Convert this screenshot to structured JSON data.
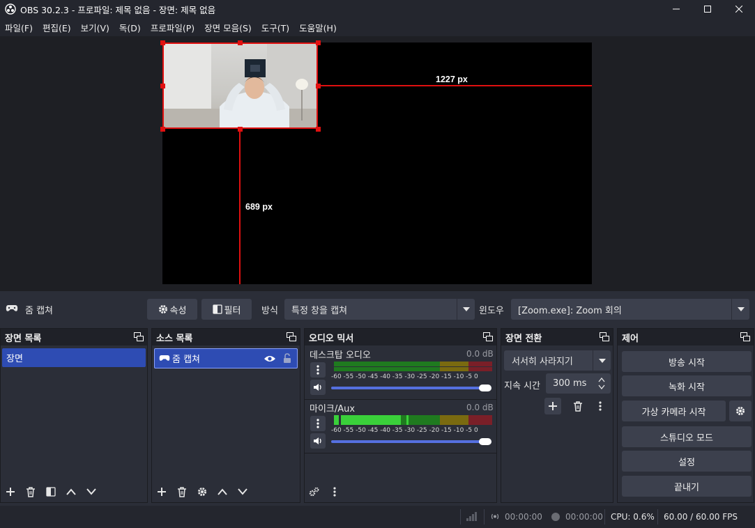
{
  "window": {
    "title": "OBS 30.2.3 - 프로파일: 제목 없음 - 장면: 제목 없음"
  },
  "menu": [
    "파일(F)",
    "편집(E)",
    "보기(V)",
    "독(D)",
    "프로파일(P)",
    "장면 모음(S)",
    "도구(T)",
    "도움말(H)"
  ],
  "preview": {
    "width_label": "1227 px",
    "height_label": "689 px"
  },
  "source_toolbar": {
    "source_name": "줌 캡쳐",
    "properties_label": "속성",
    "filters_label": "필터",
    "method_label": "방식",
    "method_value": "특정 창을 캡쳐",
    "window_label": "윈도우",
    "window_value": "[Zoom.exe]: Zoom 회의"
  },
  "scenes": {
    "title": "장면 목록",
    "items": [
      "장면"
    ]
  },
  "sources": {
    "title": "소스 목록",
    "items": [
      "줌 캡쳐"
    ]
  },
  "mixer": {
    "title": "오디오 믹서",
    "channels": [
      {
        "name": "데스크탑 오디오",
        "db": "0.0 dB",
        "level": 0.0,
        "volume": 1.0
      },
      {
        "name": "마이크/Aux",
        "db": "0.0 dB",
        "level": 0.42,
        "volume": 1.0
      }
    ],
    "ticks": "-60 -55 -50 -45 -40 -35 -30 -25 -20 -15 -10 -5 0"
  },
  "transitions": {
    "title": "장면 전환",
    "type": "서서히 사라지기",
    "duration_label": "지속 시간",
    "duration_value": "300 ms"
  },
  "controls": {
    "title": "제어",
    "stream": "방송 시작",
    "record": "녹화 시작",
    "virtualcam": "가상 카메라 시작",
    "studio": "스튜디오 모드",
    "settings": "설정",
    "exit": "끝내기"
  },
  "status": {
    "stream_time": "00:00:00",
    "record_time": "00:00:00",
    "cpu": "CPU: 0.6%",
    "fps": "60.00 / 60.00 FPS"
  },
  "colors": {
    "accent": "#2e4cb3",
    "selection": "#e01010",
    "meter_green": "#1f7a1f",
    "meter_yellow": "#7a6a10",
    "meter_red": "#7a1f28"
  }
}
